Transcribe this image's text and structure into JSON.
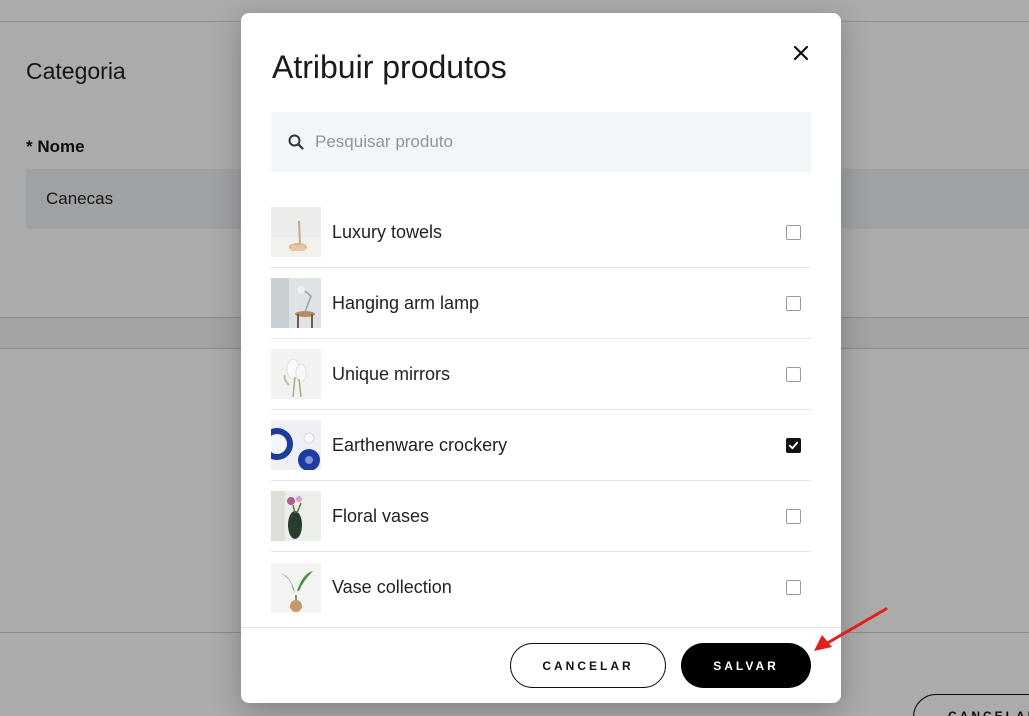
{
  "background": {
    "section_title": "Categoria",
    "name_label": "* Nome",
    "name_value": "Canecas",
    "cancel_label": "CANCELAR"
  },
  "modal": {
    "title": "Atribuir produtos",
    "close_icon": "close-icon",
    "search": {
      "placeholder": "Pesquisar produto",
      "value": "",
      "icon": "search-icon"
    },
    "products": [
      {
        "name": "Luxury towels",
        "checked": false
      },
      {
        "name": "Hanging arm lamp",
        "checked": false
      },
      {
        "name": "Unique mirrors",
        "checked": false
      },
      {
        "name": "Earthenware crockery",
        "checked": true
      },
      {
        "name": "Floral vases",
        "checked": false
      },
      {
        "name": "Vase collection",
        "checked": false
      }
    ],
    "cancel_label": "CANCELAR",
    "save_label": "SALVAR"
  },
  "colors": {
    "primary_button": "#000000",
    "annotation_arrow": "#e0201b",
    "search_bg": "#f2f6f9"
  }
}
